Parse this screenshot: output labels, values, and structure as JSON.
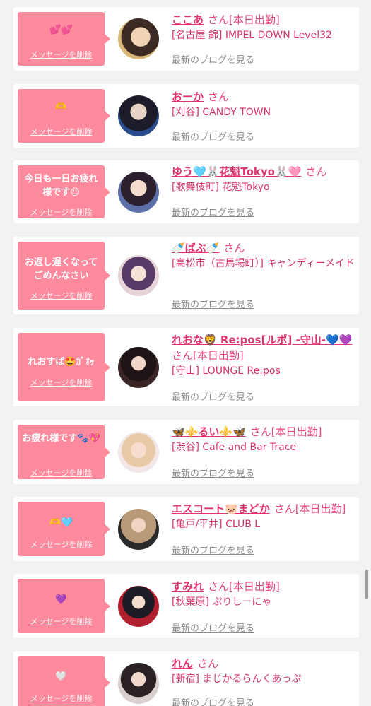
{
  "items": [
    {
      "message": "💕💕",
      "delete": "メッセージを削除",
      "name": "ここあ",
      "san": "さん",
      "status": "[本日出勤]",
      "shop": "[名古屋 錦] IMPEL DOWN Level32",
      "blog": "最新のブログを見る"
    },
    {
      "message": "🫶",
      "delete": "メッセージを削除",
      "name": "おーか",
      "san": "さん",
      "status": "",
      "shop": "[刈谷] CANDY TOWN",
      "blog": "最新のブログを見る"
    },
    {
      "message": "今日も一日お疲れ様です😉",
      "delete": "メッセージを削除",
      "name": "ゆう🩵🐰花魁Tokyo🐰🩷",
      "san": "さん",
      "status": "",
      "shop": "[歌舞伎町] 花魁Tokyo",
      "blog": "最新のブログを見る"
    },
    {
      "message": "お返し遅くなってごめんなさい",
      "delete": "メッセージを削除",
      "name": "🍼ばぶ🍼",
      "san": "さん",
      "status": "",
      "shop": "[高松市（古馬場町）] キャンディーメイド",
      "blog": "最新のブログを見る"
    },
    {
      "message": "れおすば🤩ｶﾞｵｯ",
      "delete": "メッセージを削除",
      "name": "れおな🦁 Re:pos[ルポ] -守山-💙💜",
      "san": "さん",
      "status": "[本日出勤]",
      "shop": "[守山] LOUNGE Re:pos",
      "blog": "最新のブログを見る"
    },
    {
      "message": "お疲れ様です🐾💖",
      "delete": "メッセージを削除",
      "name": "🦋⚜️るい⚜️🦋",
      "san": "さん",
      "status": "[本日出勤]",
      "shop": "[渋谷] Cafe and Bar Trace",
      "blog": "最新のブログを見る"
    },
    {
      "message": "🫶🩵",
      "delete": "メッセージを削除",
      "name": "エスコート🐷まどか",
      "san": "さん",
      "status": "[本日出勤]",
      "shop": "[亀戸/平井] CLUB L",
      "blog": "最新のブログを見る"
    },
    {
      "message": "💜",
      "delete": "メッセージを削除",
      "name": "すみれ",
      "san": "さん",
      "status": "[本日出勤]",
      "shop": "[秋葉原] ぷりしーにゃ",
      "blog": "最新のブログを見る"
    },
    {
      "message": "🤍",
      "delete": "メッセージを削除",
      "name": "れん",
      "san": "さん",
      "status": "",
      "shop": "[新宿] まじかるらんくあっぷ",
      "blog": "最新のブログを見る"
    }
  ]
}
